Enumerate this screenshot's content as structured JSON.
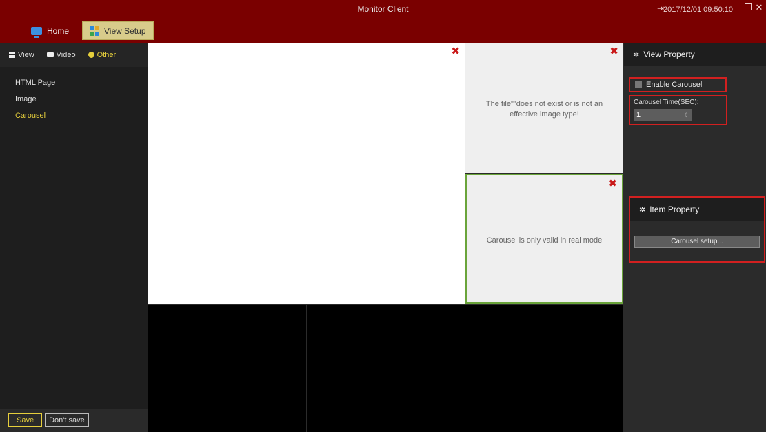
{
  "window": {
    "title": "Monitor Client",
    "datetime": "2017/12/01 09:50:10",
    "controls": {
      "logout": "⇥",
      "minimize": "—",
      "restore": "❐",
      "close": "✕"
    }
  },
  "tabs": [
    {
      "label": "Home",
      "icon": "monitor-icon"
    },
    {
      "label": "View Setup",
      "icon": "grid-icon",
      "active": true
    }
  ],
  "sidebar": {
    "subtabs": [
      {
        "label": "View",
        "icon": "grid-icon"
      },
      {
        "label": "Video",
        "icon": "camera-icon"
      },
      {
        "label": "Other",
        "icon": "circle-icon",
        "active": true
      }
    ],
    "items": [
      {
        "label": "HTML Page"
      },
      {
        "label": "Image"
      },
      {
        "label": "Carousel",
        "active": true
      }
    ],
    "save_label": "Save",
    "dont_save_label": "Don't save"
  },
  "cells": {
    "top_right_message": "The file\"\"does not exist or is not an effective image type!",
    "middle_right_message": "Carousel is only valid in real mode"
  },
  "right_panel": {
    "view_property": "View Property",
    "enable_carousel": "Enable Carousel",
    "carousel_time_label": "Carousel Time(SEC):",
    "carousel_time_value": "1",
    "item_property": "Item Property",
    "carousel_setup": "Carousel setup..."
  },
  "colors": {
    "titlebar": "#7a0000",
    "active_tab": "#d8cc8b",
    "accent_yellow": "#e6cf3c",
    "selected_cell_border": "#6aa43a",
    "highlight_red": "#d22020"
  }
}
